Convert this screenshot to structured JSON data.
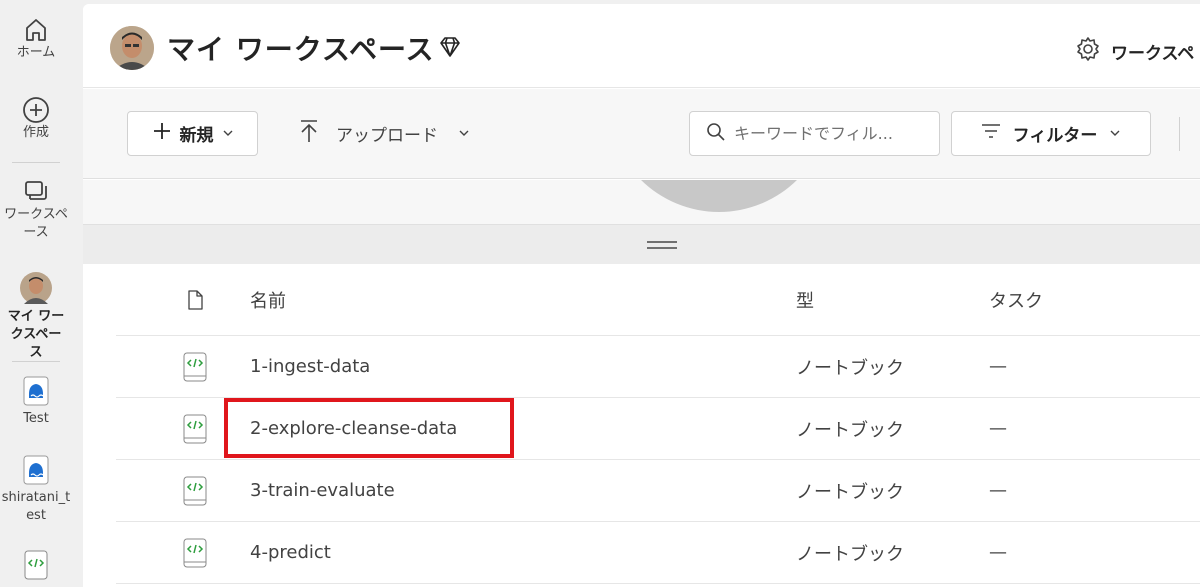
{
  "rail": {
    "home_label": "ホーム",
    "create_label": "作成",
    "workspaces_label": "ワークスペース",
    "my_workspace_label": "マイ ワークスペース",
    "items": [
      {
        "label": "Test",
        "icon": "lakehouse-icon"
      },
      {
        "label": "shiratani_test",
        "icon": "lakehouse-icon"
      }
    ]
  },
  "header": {
    "title": "マイ ワークスペース",
    "settings_label": "ワークスペ"
  },
  "toolbar": {
    "new_label": "新規",
    "upload_label": "アップロード",
    "search_placeholder": "キーワードでフィル...",
    "filter_label": "フィルター"
  },
  "table": {
    "columns": {
      "name": "名前",
      "type": "型",
      "task": "タスク"
    },
    "rows": [
      {
        "name": "1-ingest-data",
        "type": "ノートブック",
        "task": "—"
      },
      {
        "name": "2-explore-cleanse-data",
        "type": "ノートブック",
        "task": "—"
      },
      {
        "name": "3-train-evaluate",
        "type": "ノートブック",
        "task": "—"
      },
      {
        "name": "4-predict",
        "type": "ノートブック",
        "task": "—"
      }
    ],
    "highlighted_row": "2-explore-cleanse-data"
  },
  "colors": {
    "highlight": "#e0161c",
    "notebook_green": "#2e9e3e",
    "lakehouse_blue": "#1e6fd0"
  }
}
